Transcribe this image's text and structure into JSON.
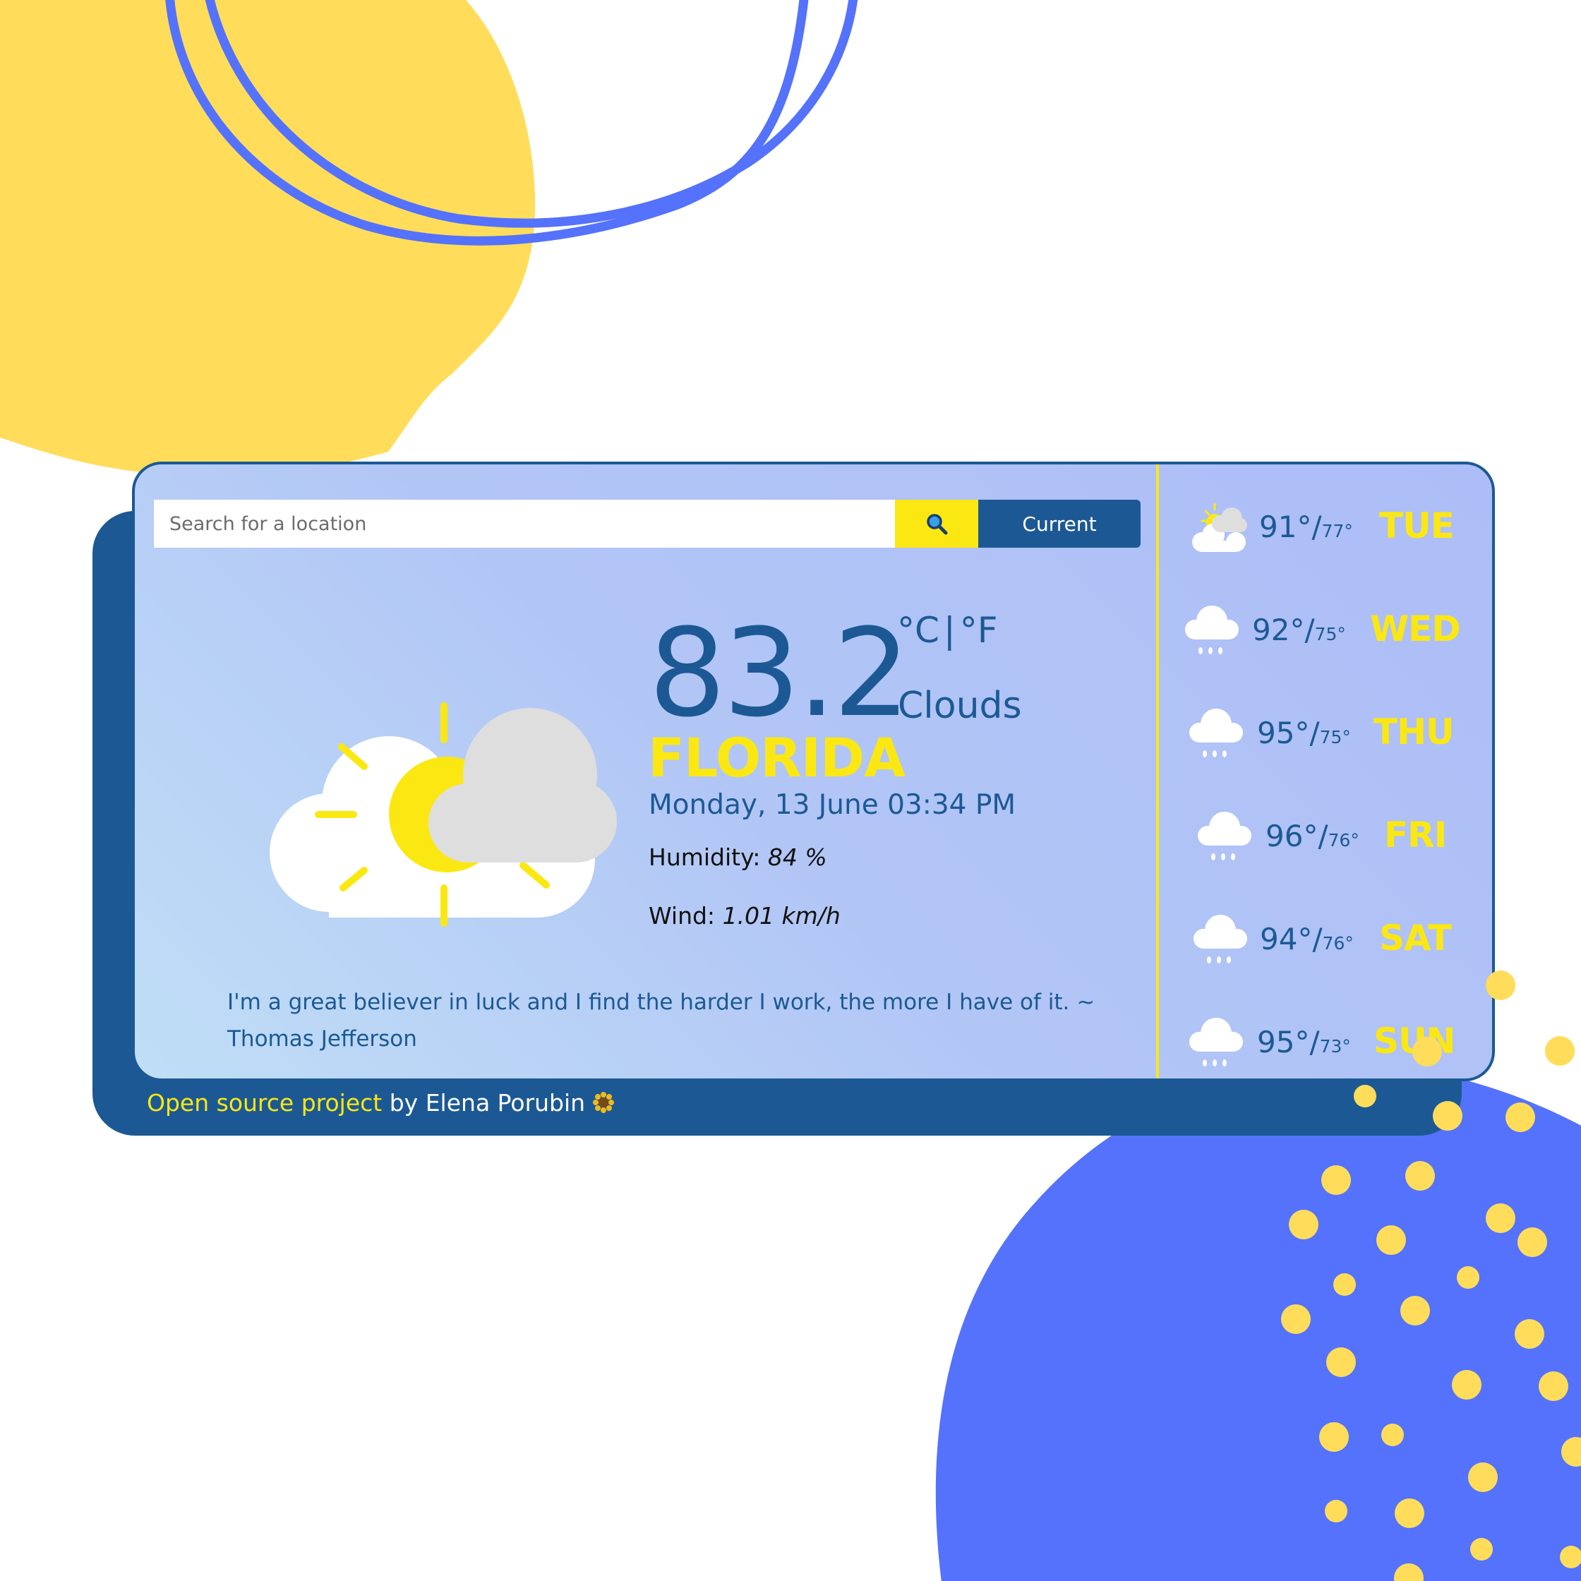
{
  "search": {
    "placeholder": "Search for a location",
    "button_icon": "search-icon"
  },
  "current_button": {
    "label": "Current"
  },
  "weather": {
    "temperature": "83.2",
    "unit_celsius": "°C",
    "unit_separator": "|",
    "unit_fahrenheit": "°F",
    "description": "Clouds",
    "city": "FLORIDA",
    "datetime": "Monday, 13 June 03:34 PM",
    "humidity_label": "Humidity:",
    "humidity_value": "84 %",
    "wind_label": "Wind:",
    "wind_value": "1.01 km/h",
    "icon": "partly-cloudy-icon"
  },
  "quote": {
    "text": "I'm a great believer in luck and I find the harder I work, the more I have of it. ~ Thomas Jefferson"
  },
  "forecast": [
    {
      "high": "91°/",
      "low": "77°",
      "day": "TUE",
      "icon": "partly-cloudy-icon"
    },
    {
      "high": "92°/",
      "low": "75°",
      "day": "WED",
      "icon": "rain-cloud-icon"
    },
    {
      "high": "95°/",
      "low": "75°",
      "day": "THU",
      "icon": "rain-cloud-icon"
    },
    {
      "high": "96°/",
      "low": "76°",
      "day": "FRI",
      "icon": "rain-cloud-icon"
    },
    {
      "high": "94°/",
      "low": "76°",
      "day": "SAT",
      "icon": "rain-cloud-icon"
    },
    {
      "high": "95°/",
      "low": "73°",
      "day": "SUN",
      "icon": "rain-cloud-icon"
    }
  ],
  "footer": {
    "link_text": "Open source project",
    "by_text": " by Elena Porubin",
    "flower_icon": "sunflower-icon"
  },
  "colors": {
    "primary": "#1c5994",
    "accent": "#fbe813",
    "card_bg": "#b2c6f6",
    "blob_yellow": "#ffdd5b",
    "blob_blue": "#5472fb"
  }
}
